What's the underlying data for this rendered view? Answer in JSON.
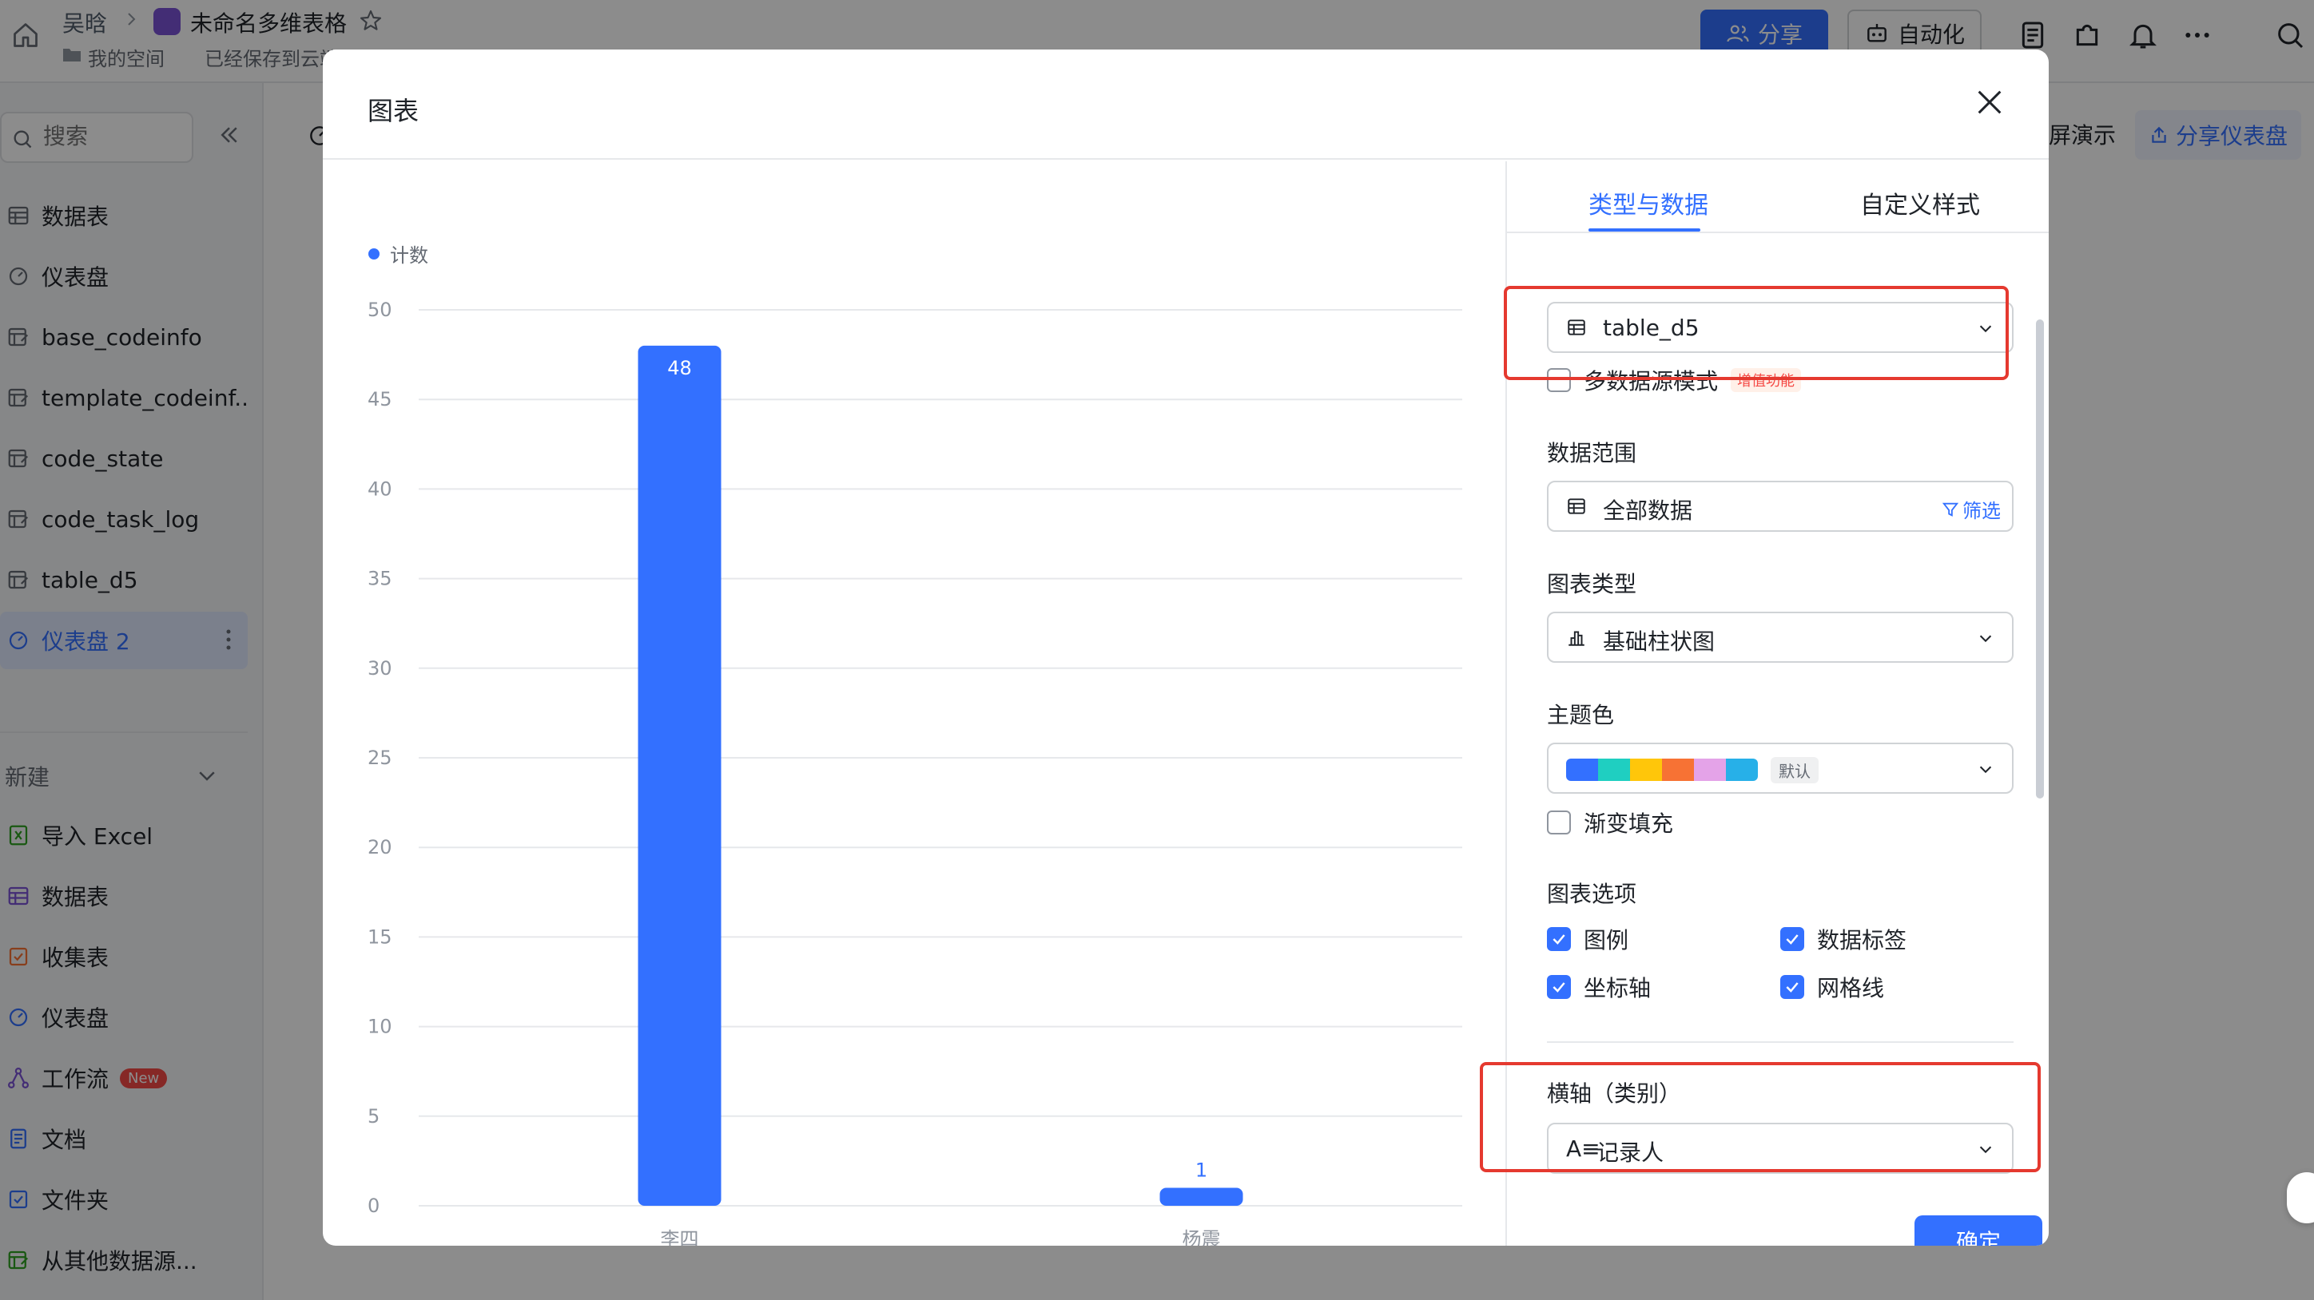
{
  "topbar": {
    "user": "吴晗",
    "doc_title": "未命名多维表格",
    "space": "我的空间",
    "saved": "已经保存到云端",
    "share_label": "分享",
    "automation_label": "自动化"
  },
  "sidebar": {
    "search_placeholder": "搜索",
    "items": [
      {
        "label": "数据表",
        "icon": "grid-icon"
      },
      {
        "label": "仪表盘",
        "icon": "dashboard-icon"
      },
      {
        "label": "base_codeinfo",
        "icon": "table-edit-icon"
      },
      {
        "label": "template_codeinf...",
        "icon": "table-edit-icon"
      },
      {
        "label": "code_state",
        "icon": "table-edit-icon"
      },
      {
        "label": "code_task_log",
        "icon": "table-edit-icon"
      },
      {
        "label": "table_d5",
        "icon": "table-edit-icon"
      },
      {
        "label": "仪表盘 2",
        "icon": "dashboard-icon"
      }
    ],
    "new_header": "新建",
    "new_items": [
      {
        "label": "导入 Excel",
        "icon": "excel-icon"
      },
      {
        "label": "数据表",
        "icon": "grid-icon"
      },
      {
        "label": "收集表",
        "icon": "form-icon"
      },
      {
        "label": "仪表盘",
        "icon": "dashboard-icon"
      },
      {
        "label": "工作流",
        "icon": "workflow-icon",
        "badge": "New"
      },
      {
        "label": "文档",
        "icon": "doc-icon"
      },
      {
        "label": "文件夹",
        "icon": "folder-icon"
      },
      {
        "label": "从其他数据源...",
        "icon": "datasource-icon"
      }
    ]
  },
  "main": {
    "present_label": "屏演示",
    "share_dashboard_label": "分享仪表盘"
  },
  "modal": {
    "title": "图表",
    "tabs": [
      "类型与数据",
      "自定义样式"
    ],
    "data_source": {
      "value": "table_d5"
    },
    "multi_source": {
      "label": "多数据源模式",
      "badge": "增值功能",
      "checked": false
    },
    "data_range": {
      "label": "数据范围",
      "value": "全部数据",
      "filter_label": "筛选"
    },
    "chart_type": {
      "label": "图表类型",
      "value": "基础柱状图"
    },
    "theme": {
      "label": "主题色",
      "colors": [
        "#3370ff",
        "#1fcfc1",
        "#ffc60a",
        "#f77234",
        "#e4a3e8",
        "#27b0e8"
      ],
      "tag": "默认"
    },
    "gradient": {
      "label": "渐变填充",
      "checked": false
    },
    "options": {
      "label": "图表选项",
      "items": [
        {
          "label": "图例",
          "checked": true
        },
        {
          "label": "数据标签",
          "checked": true
        },
        {
          "label": "坐标轴",
          "checked": true
        },
        {
          "label": "网格线",
          "checked": true
        }
      ]
    },
    "x_axis": {
      "label": "横轴（类别）",
      "field_icon": "A≡",
      "value": "记录人"
    },
    "confirm_label": "确定",
    "highlight_color": "#e5392f"
  },
  "chart_data": {
    "type": "bar",
    "legend": "计数",
    "legend_position": "top-left",
    "categories": [
      "李四",
      "杨震"
    ],
    "values": [
      48,
      1
    ],
    "ylim": [
      0,
      50
    ],
    "yticks": [
      0,
      5,
      10,
      15,
      20,
      25,
      30,
      35,
      40,
      45,
      50
    ],
    "grid": true,
    "color": "#3370ff"
  }
}
